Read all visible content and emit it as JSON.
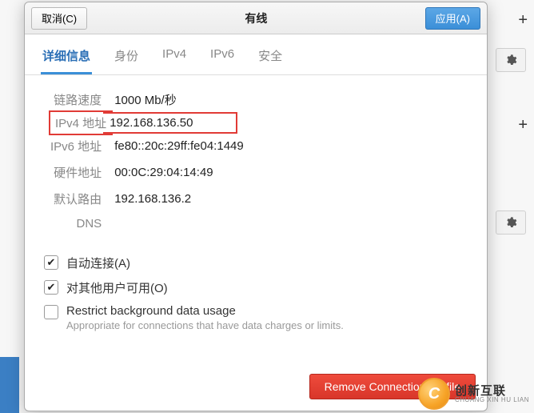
{
  "titlebar": {
    "cancel": "取消(C)",
    "title": "有线",
    "apply": "应用(A)"
  },
  "tabs": {
    "details": "详细信息",
    "identity": "身份",
    "ipv4": "IPv4",
    "ipv6": "IPv6",
    "security": "安全"
  },
  "details": {
    "link_speed_k": "链路速度",
    "link_speed_v": "1000 Mb/秒",
    "ipv4_k": "IPv4 地址",
    "ipv4_v": "192.168.136.50",
    "ipv6_k": "IPv6 地址",
    "ipv6_v": "fe80::20c:29ff:fe04:1449",
    "mac_k": "硬件地址",
    "mac_v": "00:0C:29:04:14:49",
    "route_k": "默认路由",
    "route_v": "192.168.136.2",
    "dns_k": "DNS",
    "dns_v": ""
  },
  "options": {
    "auto_connect": "自动连接(A)",
    "all_users": "对其他用户可用(O)",
    "restrict_bg": "Restrict background data usage",
    "restrict_bg_sub": "Appropriate for connections that have data charges or limits."
  },
  "footer": {
    "remove": "Remove Connection Profile"
  },
  "logo": {
    "cn": "创新互联",
    "en": "CHUANG XIN HU LIAN",
    "mark": "C"
  }
}
